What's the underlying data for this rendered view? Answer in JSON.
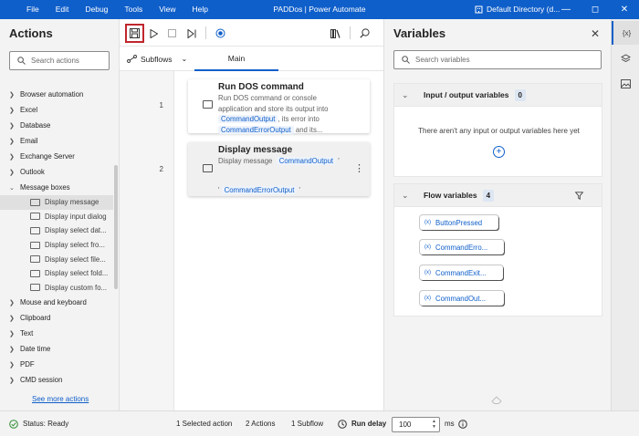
{
  "titlebar": {
    "menu": [
      "File",
      "Edit",
      "Debug",
      "Tools",
      "View",
      "Help"
    ],
    "title": "PADDos | Power Automate",
    "directory": "Default Directory (d..."
  },
  "actions": {
    "title": "Actions",
    "search_placeholder": "Search actions",
    "categories": [
      {
        "label": "Browser automation",
        "expanded": false
      },
      {
        "label": "Excel",
        "expanded": false
      },
      {
        "label": "Database",
        "expanded": false
      },
      {
        "label": "Email",
        "expanded": false
      },
      {
        "label": "Exchange Server",
        "expanded": false
      },
      {
        "label": "Outlook",
        "expanded": false
      },
      {
        "label": "Message boxes",
        "expanded": true
      }
    ],
    "message_box_items": [
      "Display message",
      "Display input dialog",
      "Display select dat...",
      "Display select fro...",
      "Display select file...",
      "Display select fold...",
      "Display custom fo..."
    ],
    "categories_after": [
      "Mouse and keyboard",
      "Clipboard",
      "Text",
      "Date time",
      "PDF",
      "CMD session"
    ],
    "see_more": "See more actions"
  },
  "designer": {
    "subflows_label": "Subflows",
    "main_tab": "Main",
    "steps": [
      {
        "number": "1",
        "title": "Run DOS command",
        "desc_1": "Run DOS command or console",
        "desc_2": "application and store its output into",
        "var_output": "CommandOutput",
        "desc_3": ", its error into",
        "var_error": "CommandErrorOutput",
        "desc_4": " and its..."
      },
      {
        "number": "2",
        "title": "Display message",
        "desc_prefix": "Display message",
        "var_output": "CommandOutput",
        "quote_1": "'",
        "quote_2": "'",
        "var_error": "CommandErrorOutput",
        "quote_3": "'",
        "more": "⋮"
      }
    ]
  },
  "variables": {
    "title": "Variables",
    "search_placeholder": "Search variables",
    "io_section": {
      "label": "Input / output variables",
      "count": "0",
      "empty_message": "There aren't any input or output variables here yet"
    },
    "flow_section": {
      "label": "Flow variables",
      "count": "4"
    },
    "flow_vars": [
      "ButtonPressed",
      "CommandErro...",
      "CommandExit...",
      "CommandOut..."
    ]
  },
  "rail": {
    "variables_icon": "{x}"
  },
  "status": {
    "ready": "Status: Ready",
    "selected": "1 Selected action",
    "actions_count": "2 Actions",
    "subflows_count": "1 Subflow",
    "run_delay_label": "Run delay",
    "run_delay_value": "100",
    "unit": "ms"
  },
  "colors": {
    "accent": "#0f5fca",
    "save_highlight": "#c0262d",
    "status_ok": "#2e8b2e"
  }
}
